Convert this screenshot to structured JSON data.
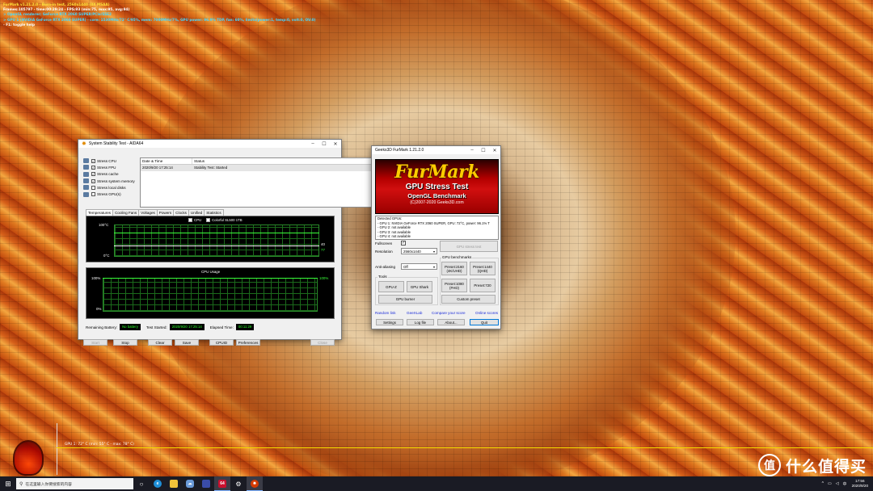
{
  "osd": {
    "line1": "FurMark v1.21.2.0 - Burn-in test, 2560x1440 (0X MSAA)",
    "line2": "Frames:105797 - time:00:29:24 - FPS:93 (min:75, max:95, avg:94)",
    "line3": "> OpenGL renderer: GeForce RTX 2060 SUPER/PCIe/SSE2",
    "line4": "> GPU 1 (NVIDIA GeForce RTX 2060 SUPER) - core: 1530MHz/72° C/95%, mem: 7000MHz/7%, GPU power: 96.9% TDP, fan: 60%, limits(power:1, temp:0, volt:0, OV:0)",
    "line5": "- F1: toggle help"
  },
  "aida": {
    "title": "System Stability Test - AIDA64",
    "checks": [
      {
        "label": "Stress CPU",
        "checked": true
      },
      {
        "label": "Stress FPU",
        "checked": true
      },
      {
        "label": "Stress cache",
        "checked": true
      },
      {
        "label": "Stress system memory",
        "checked": true
      },
      {
        "label": "Stress local disks",
        "checked": false
      },
      {
        "label": "Stress GPU(s)",
        "checked": false
      }
    ],
    "log_headers": [
      "Date & Time",
      "Status"
    ],
    "log_rows": [
      [
        "2020/9/20 17:25:14",
        "Stability Test: Started"
      ]
    ],
    "tabs": [
      "Temperatures",
      "Cooling Fans",
      "Voltages",
      "Powers",
      "Clocks",
      "Unified",
      "Statistics"
    ],
    "temp_graph": {
      "top_label": "100°C",
      "bottom_label": "0°C",
      "legend_cpu": "CPU",
      "legend_disk": "Colorful SL500 1TB",
      "val1": "40",
      "val2": "77"
    },
    "cpu_graph": {
      "title": "CPU Usage",
      "top_left": "100%",
      "top_right": "100%",
      "bottom_left": "0%"
    },
    "status": {
      "battery_label": "Remaining Battery:",
      "battery_value": "No battery",
      "started_label": "Test Started:",
      "started_value": "2020/9/20 17:25:14",
      "elapsed_label": "Elapsed Time:",
      "elapsed_value": "00:11:29"
    },
    "buttons": [
      "Start",
      "Stop",
      "Clear",
      "Save",
      "CPUID",
      "Preferences",
      "Close"
    ]
  },
  "furmark": {
    "title": "Geeks3D FurMark 1.21.2.0",
    "banner_logo": "FurMark",
    "banner_sub1": "GPU Stress Test",
    "banner_sub2": "OpenGL Benchmark",
    "banner_sub3": "(C)2007-2020 Geeks3D.com",
    "gpu_lines": [
      "Detected GPUs:",
      "- GPU 1: NVIDIA GeForce RTX 2060 SUPER, GPU: 72°C, power: 96.1% T",
      "- GPU 2: not available",
      "- GPU 3: not available",
      "- GPU 4: not available"
    ],
    "fullscreen_label": "Fullscreen",
    "resolution_label": "Resolution",
    "resolution_value": "2560x1440",
    "aa_label": "Anti-aliasing",
    "aa_value": "Off",
    "stress_btn": "GPU stress test",
    "bench_group": "GPU benchmarks",
    "preset2160": "Preset:2160\n(4K/UHD)",
    "preset1440": "Preset:1440\n(QHD)",
    "preset1080": "Preset:1080\n(FHD)",
    "preset720": "Preset:720",
    "custom_preset": "Custom preset",
    "tools_group": "Tools",
    "gpuz": "GPU-Z",
    "gpushark": "GPU Shark",
    "gpuburner": "GPU burner",
    "link_random": "Random link",
    "link_geekslab": "GeeXLab",
    "link_compare": "Compare your score",
    "link_online": "Online scores",
    "btn_settings": "Settings",
    "btn_logfile": "Log file",
    "btn_about": "About...",
    "btn_quit": "Quit"
  },
  "osd_graph": {
    "label": "GPU 1: 72° C (min: 55° C - max: 78° C)"
  },
  "taskbar": {
    "search_placeholder": "在这里输入你要搜索的内容",
    "time": "17:56",
    "date": "2020/9/20",
    "aida_badge": "64"
  },
  "watermark": {
    "logo": "值",
    "text": "什么值得买"
  }
}
